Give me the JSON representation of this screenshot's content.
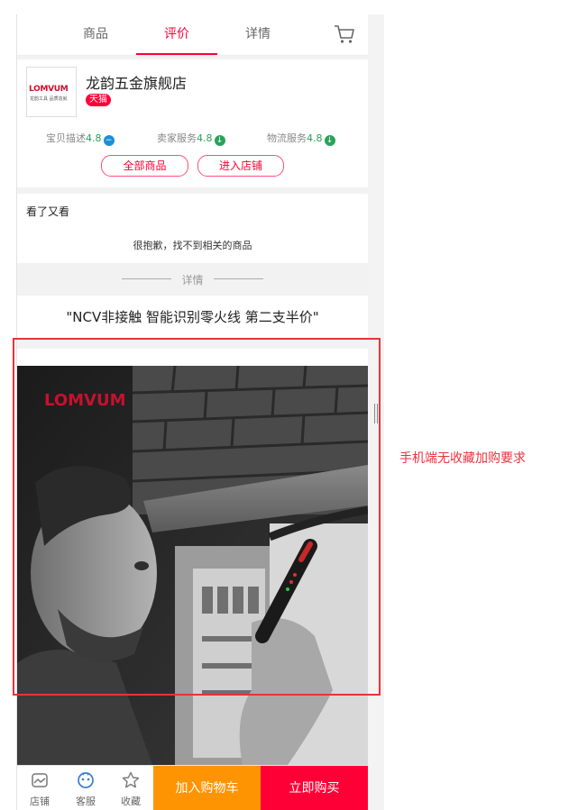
{
  "tabs": [
    {
      "label": "商品"
    },
    {
      "label": "评价"
    },
    {
      "label": "详情"
    }
  ],
  "active_tab": "评价",
  "icons": {
    "cart": "cart-icon",
    "shop": "shop-icon",
    "service": "chat-face-icon",
    "favorite": "star-icon"
  },
  "shop": {
    "logo_text": "LOMVUM",
    "logo_subtext": "龙韵工具 品质造就",
    "name": "龙韵五金旗舰店",
    "badge": "天猫",
    "scores": [
      {
        "label": "宝贝描述",
        "value": "4.8",
        "indicator": "−",
        "indicator_color": "#1a8fd8"
      },
      {
        "label": "卖家服务",
        "value": "4.8",
        "indicator": "↓",
        "indicator_color": "#29a35a"
      },
      {
        "label": "物流服务",
        "value": "4.8",
        "indicator": "↓",
        "indicator_color": "#29a35a"
      }
    ],
    "buttons": {
      "all_products": "全部商品",
      "enter_shop": "进入店铺"
    }
  },
  "see_also": {
    "title": "看了又看",
    "empty_message": "很抱歉，找不到相关的商品"
  },
  "detail_divider": "详情",
  "product_title": "\"NCV非接触 智能识别零火线 第二支半价\"",
  "photo": {
    "brand": "LOMVUM"
  },
  "bottom_bar": {
    "shop_label": "店铺",
    "service_label": "客服",
    "favorite_label": "收藏",
    "add_to_cart": "加入购物车",
    "buy_now": "立即购买"
  },
  "annotation": {
    "note": "手机端无收藏加购要求",
    "color": "#e8333c"
  },
  "colors": {
    "accent": "#ff0036",
    "cart_button": "#ff9402"
  }
}
